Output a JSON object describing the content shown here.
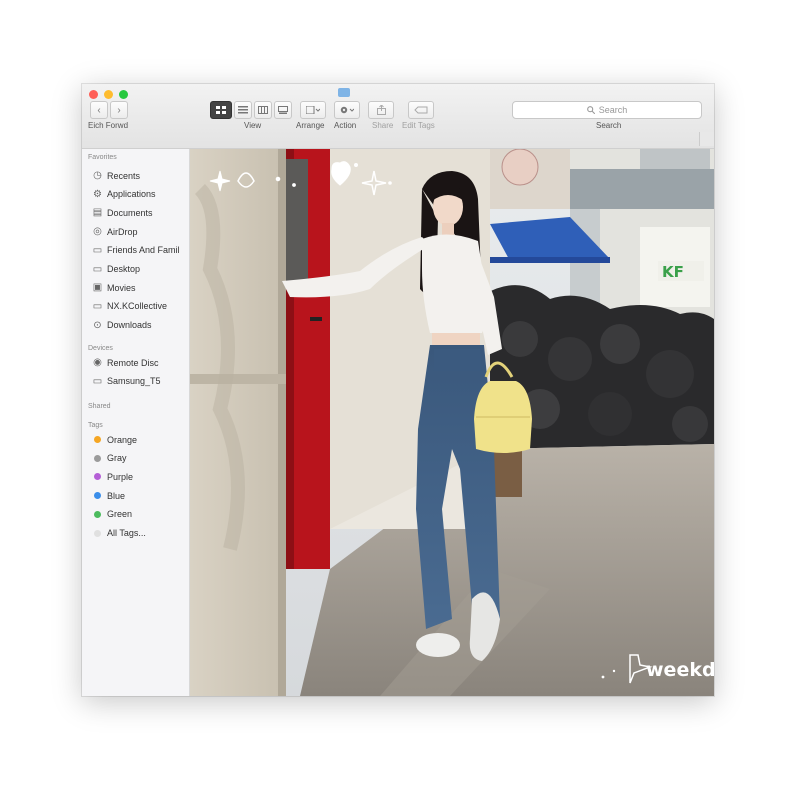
{
  "window": {
    "traffic_lights": [
      "#ff5f57",
      "#febc2e",
      "#28c840"
    ],
    "folder_icon": "folder-icon"
  },
  "toolbar": {
    "back_icon": "‹",
    "forward_icon": "›",
    "location_label": "Eich Forwd",
    "view_label": "View",
    "arrange_label": "Arrange",
    "action_label": "Action",
    "share_label": "Share",
    "edit_tags_label": "Edit Tags",
    "search_placeholder": "Search",
    "search_label": "Search"
  },
  "sidebar": {
    "favorites_header": "Favorites",
    "favorites": [
      {
        "label": "Recents",
        "icon": "clock-icon",
        "glyph": "◷"
      },
      {
        "label": "Applications",
        "icon": "applications-icon",
        "glyph": "⚙"
      },
      {
        "label": "Documents",
        "icon": "documents-icon",
        "glyph": "▤"
      },
      {
        "label": "AirDrop",
        "icon": "airdrop-icon",
        "glyph": "◎"
      },
      {
        "label": "Friends And Famil",
        "icon": "folder-icon",
        "glyph": "▭"
      },
      {
        "label": "Desktop",
        "icon": "desktop-icon",
        "glyph": "▭"
      },
      {
        "label": "Movies",
        "icon": "movies-icon",
        "glyph": "▣"
      },
      {
        "label": "NX.KCollective",
        "icon": "folder-icon",
        "glyph": "▭"
      },
      {
        "label": "Downloads",
        "icon": "downloads-icon",
        "glyph": "⊙"
      }
    ],
    "devices_header": "Devices",
    "devices": [
      {
        "label": "Remote Disc",
        "icon": "disc-icon",
        "glyph": "◉"
      },
      {
        "label": "Samsung_T5",
        "icon": "drive-icon",
        "glyph": "▭"
      }
    ],
    "shared_header": "Shared",
    "tags_header": "Tags",
    "tags": [
      {
        "label": "Orange",
        "color": "#f5a623"
      },
      {
        "label": "Gray",
        "color": "#9b9b9b"
      },
      {
        "label": "Purple",
        "color": "#b45fd6"
      },
      {
        "label": "Blue",
        "color": "#3b8eea"
      },
      {
        "label": "Green",
        "color": "#4cbb5e"
      },
      {
        "label": "All Tags...",
        "color": "#e0e0e0"
      }
    ]
  },
  "photo": {
    "watermark": "weekday",
    "background_sign": "KF",
    "colors": {
      "red_door": "#b8141c",
      "tent": "#2f5fb8",
      "bag": "#f0e28a",
      "jeans": "#3e5f86"
    }
  }
}
